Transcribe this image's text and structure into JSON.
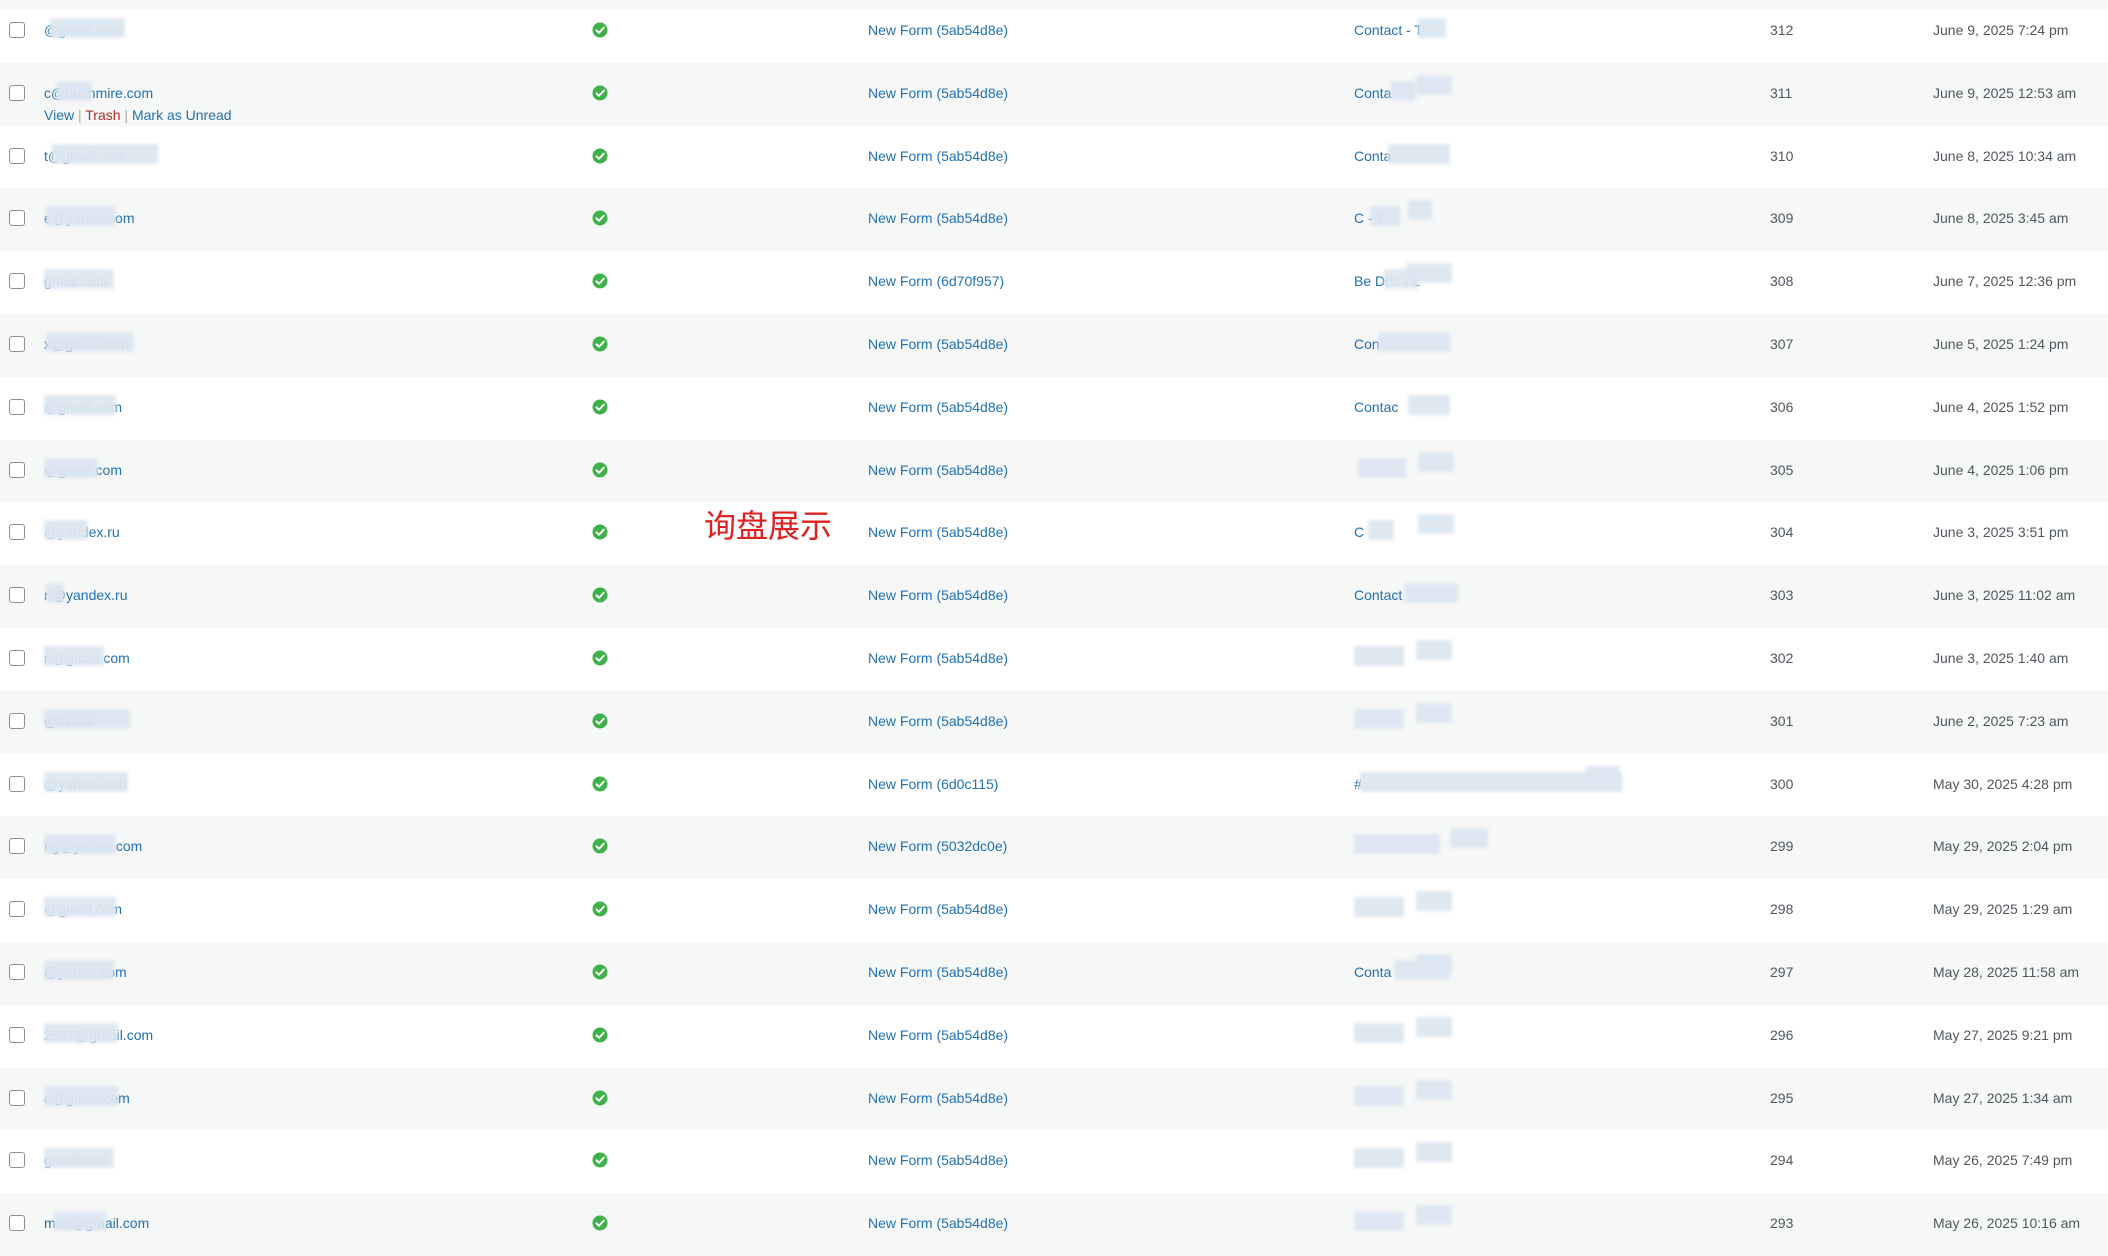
{
  "row_actions": {
    "view": "View",
    "trash": "Trash",
    "mark_unread": "Mark as Unread",
    "sep": " | "
  },
  "annotation": "询盘展示",
  "rows": [
    {
      "email": "@gmail.com",
      "form": "New Form (5ab54d8e)",
      "source": "Contact - T",
      "id": "312",
      "date": "June 9, 2025 7:24 pm"
    },
    {
      "email": "c@bushmire.com",
      "form": "New Form (5ab54d8e)",
      "source": "Conta",
      "id": "311",
      "date": "June 9, 2025 12:53 am"
    },
    {
      "email": "t@gmail.com",
      "form": "New Form (5ab54d8e)",
      "source": "Conta",
      "id": "310",
      "date": "June 8, 2025 10:34 am"
    },
    {
      "email": "e@yahoo.com",
      "form": "New Form (5ab54d8e)",
      "source": "C - T",
      "id": "309",
      "date": "June 8, 2025 3:45 am"
    },
    {
      "email": "gmail.com",
      "form": "New Form (6d70f957)",
      "source": "Be Dist TZ",
      "id": "308",
      "date": "June 7, 2025 12:36 pm"
    },
    {
      "email": "x@gmail.com",
      "form": "New Form (5ab54d8e)",
      "source": "Con",
      "id": "307",
      "date": "June 5, 2025 1:24 pm"
    },
    {
      "email": "@gmail.com",
      "form": "New Form (5ab54d8e)",
      "source": "Contac",
      "id": "306",
      "date": "June 4, 2025 1:52 pm"
    },
    {
      "email": "@gmail.com",
      "form": "New Form (5ab54d8e)",
      "source": "",
      "id": "305",
      "date": "June 4, 2025 1:06 pm"
    },
    {
      "email": "@yandex.ru",
      "form": "New Form (5ab54d8e)",
      "source": "C",
      "id": "304",
      "date": "June 3, 2025 3:51 pm"
    },
    {
      "email": "n@yandex.ru",
      "form": "New Form (5ab54d8e)",
      "source": "Contact",
      "id": "303",
      "date": "June 3, 2025 11:02 am"
    },
    {
      "email": "n@gmail.com",
      "form": "New Form (5ab54d8e)",
      "source": "",
      "id": "302",
      "date": "June 3, 2025 1:40 am"
    },
    {
      "email": "@live.ie",
      "form": "New Form (5ab54d8e)",
      "source": "",
      "id": "301",
      "date": "June 2, 2025 7:23 am"
    },
    {
      "email": "@yahoo.com",
      "form": "New Form (6d0c115)",
      "source": "#",
      "id": "300",
      "date": "May 30, 2025 4:28 pm"
    },
    {
      "email": "ng@yahoo.com",
      "form": "New Form (5032dc0e)",
      "source": "",
      "id": "299",
      "date": "May 29, 2025 2:04 pm"
    },
    {
      "email": "@gmail.com",
      "form": "New Form (5ab54d8e)",
      "source": "",
      "id": "298",
      "date": "May 29, 2025 1:29 am"
    },
    {
      "email": "@yahoo.com",
      "form": "New Form (5ab54d8e)",
      "source": "Conta",
      "id": "297",
      "date": "May 28, 2025 11:58 am"
    },
    {
      "email": "2607@gmail.com",
      "form": "New Form (5ab54d8e)",
      "source": "",
      "id": "296",
      "date": "May 27, 2025 9:21 pm"
    },
    {
      "email": "a@gmail.com",
      "form": "New Form (5ab54d8e)",
      "source": "",
      "id": "295",
      "date": "May 27, 2025 1:34 am"
    },
    {
      "email": "gmail.com",
      "form": "New Form (5ab54d8e)",
      "source": "",
      "id": "294",
      "date": "May 26, 2025 7:49 pm"
    },
    {
      "email": "mdo@gmail.com",
      "form": "New Form (5ab54d8e)",
      "source": "",
      "id": "293",
      "date": "May 26, 2025 10:16 am"
    }
  ],
  "colors": {
    "link": "#2271b1",
    "text": "#50575e",
    "alt_row": "#f6f7f7",
    "success": "#3db14a",
    "trash": "#b32d2e",
    "annotation": "#e02020"
  },
  "icons": {
    "status": "check-circle-icon"
  }
}
